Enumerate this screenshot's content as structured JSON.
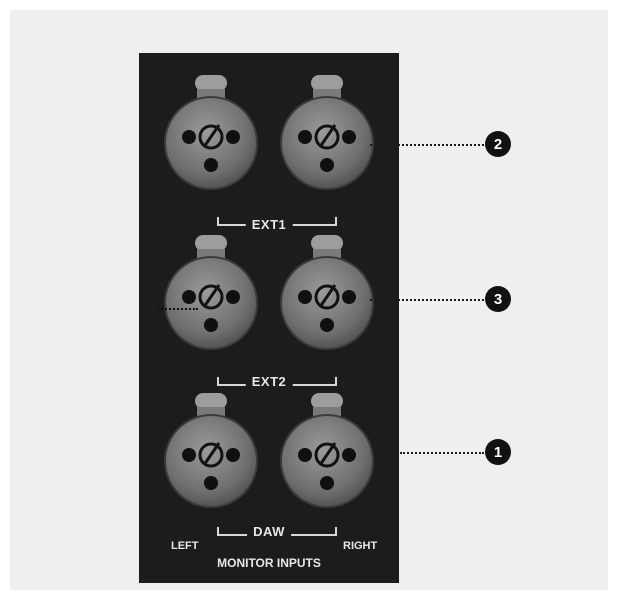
{
  "connector_panel": {
    "background_color": "#1c1c1c",
    "groups": [
      {
        "id": "ext1",
        "label": "EXT1"
      },
      {
        "id": "ext2",
        "label": "EXT2"
      },
      {
        "id": "daw",
        "label": "DAW"
      }
    ],
    "side_labels": {
      "left": "LEFT",
      "right": "RIGHT"
    },
    "panel_title": "MONITOR INPUTS"
  },
  "callouts": [
    {
      "number": "2",
      "target": "EXT1 inputs"
    },
    {
      "number": "3",
      "target": "EXT2 inputs"
    },
    {
      "number": "1",
      "target": "DAW inputs"
    }
  ]
}
